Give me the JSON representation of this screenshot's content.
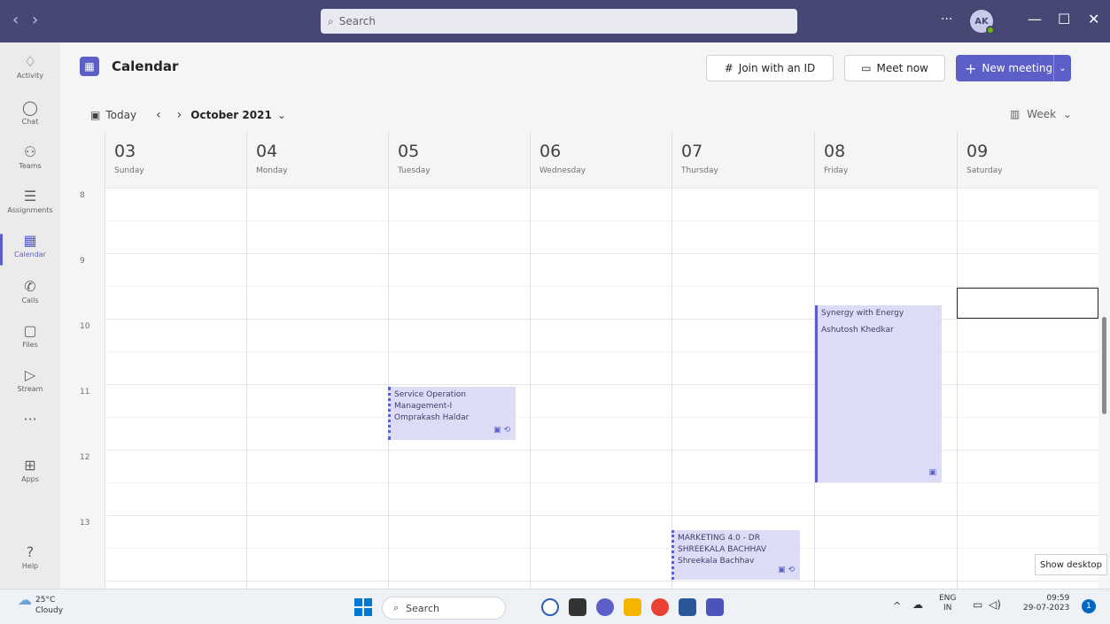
{
  "window": {
    "nav_back": "‹",
    "nav_forward": "›",
    "search_placeholder": "Search",
    "more": "···",
    "avatar": "AK",
    "minimize": "—",
    "maximize": "☐",
    "close": "✕"
  },
  "rail": [
    {
      "label": "Activity",
      "icon": "bell-icon",
      "glyph": "♢"
    },
    {
      "label": "Chat",
      "icon": "chat-icon",
      "glyph": "◯"
    },
    {
      "label": "Teams",
      "icon": "teams-icon",
      "glyph": "⚇"
    },
    {
      "label": "Assignments",
      "icon": "assignments-icon",
      "glyph": "☰"
    },
    {
      "label": "Calendar",
      "icon": "calendar-icon",
      "glyph": "▦"
    },
    {
      "label": "Calls",
      "icon": "phone-icon",
      "glyph": "✆"
    },
    {
      "label": "Files",
      "icon": "file-icon",
      "glyph": "▢"
    },
    {
      "label": "Stream",
      "icon": "stream-icon",
      "glyph": "▷"
    },
    {
      "label": "",
      "icon": "more-icon",
      "glyph": "···"
    },
    {
      "label": "Apps",
      "icon": "apps-icon",
      "glyph": "⊞"
    },
    {
      "label": "Help",
      "icon": "help-icon",
      "glyph": "?"
    }
  ],
  "header": {
    "title": "Calendar",
    "join_label": "Join with an ID",
    "meet_label": "Meet now",
    "new_meeting_label": "New meeting"
  },
  "toolbar": {
    "today_label": "Today",
    "month_label": "October 2021",
    "view_label": "Week"
  },
  "days": [
    {
      "num": "03",
      "name": "Sunday"
    },
    {
      "num": "04",
      "name": "Monday"
    },
    {
      "num": "05",
      "name": "Tuesday"
    },
    {
      "num": "06",
      "name": "Wednesday"
    },
    {
      "num": "07",
      "name": "Thursday"
    },
    {
      "num": "08",
      "name": "Friday"
    },
    {
      "num": "09",
      "name": "Saturday"
    }
  ],
  "hours": [
    "8",
    "9",
    "10",
    "11",
    "12",
    "13"
  ],
  "events": [
    {
      "title_line1": "Service Operation",
      "title_line2": "Management-I",
      "organizer": "Omprakash Haldar",
      "day": "Tuesday",
      "start": "11:00",
      "end": "11:30",
      "recurring": true
    },
    {
      "title_line1": "Synergy with Energy",
      "title_line2": "",
      "organizer": "Ashutosh Khedkar",
      "day": "Friday",
      "start": "9:45",
      "end": "12:30",
      "recurring": false
    },
    {
      "title_line1": "MARKETING 4.0 - DR",
      "title_line2": "SHREEKALA BACHHAV",
      "organizer": "Shreekala Bachhav",
      "day": "Thursday",
      "start": "13:10",
      "end": "13:45",
      "recurring": true
    }
  ],
  "show_desktop": "Show desktop",
  "taskbar": {
    "temperature": "25°C",
    "condition": "Cloudy",
    "search_label": "Search",
    "lang_top": "ENG",
    "lang_bottom": "IN",
    "time": "09:59",
    "date": "29-07-2023",
    "notifications": "1"
  },
  "colors": {
    "titlebar": "#464775",
    "accent": "#5b5fc7",
    "event_bg": "#dcdcf6"
  }
}
